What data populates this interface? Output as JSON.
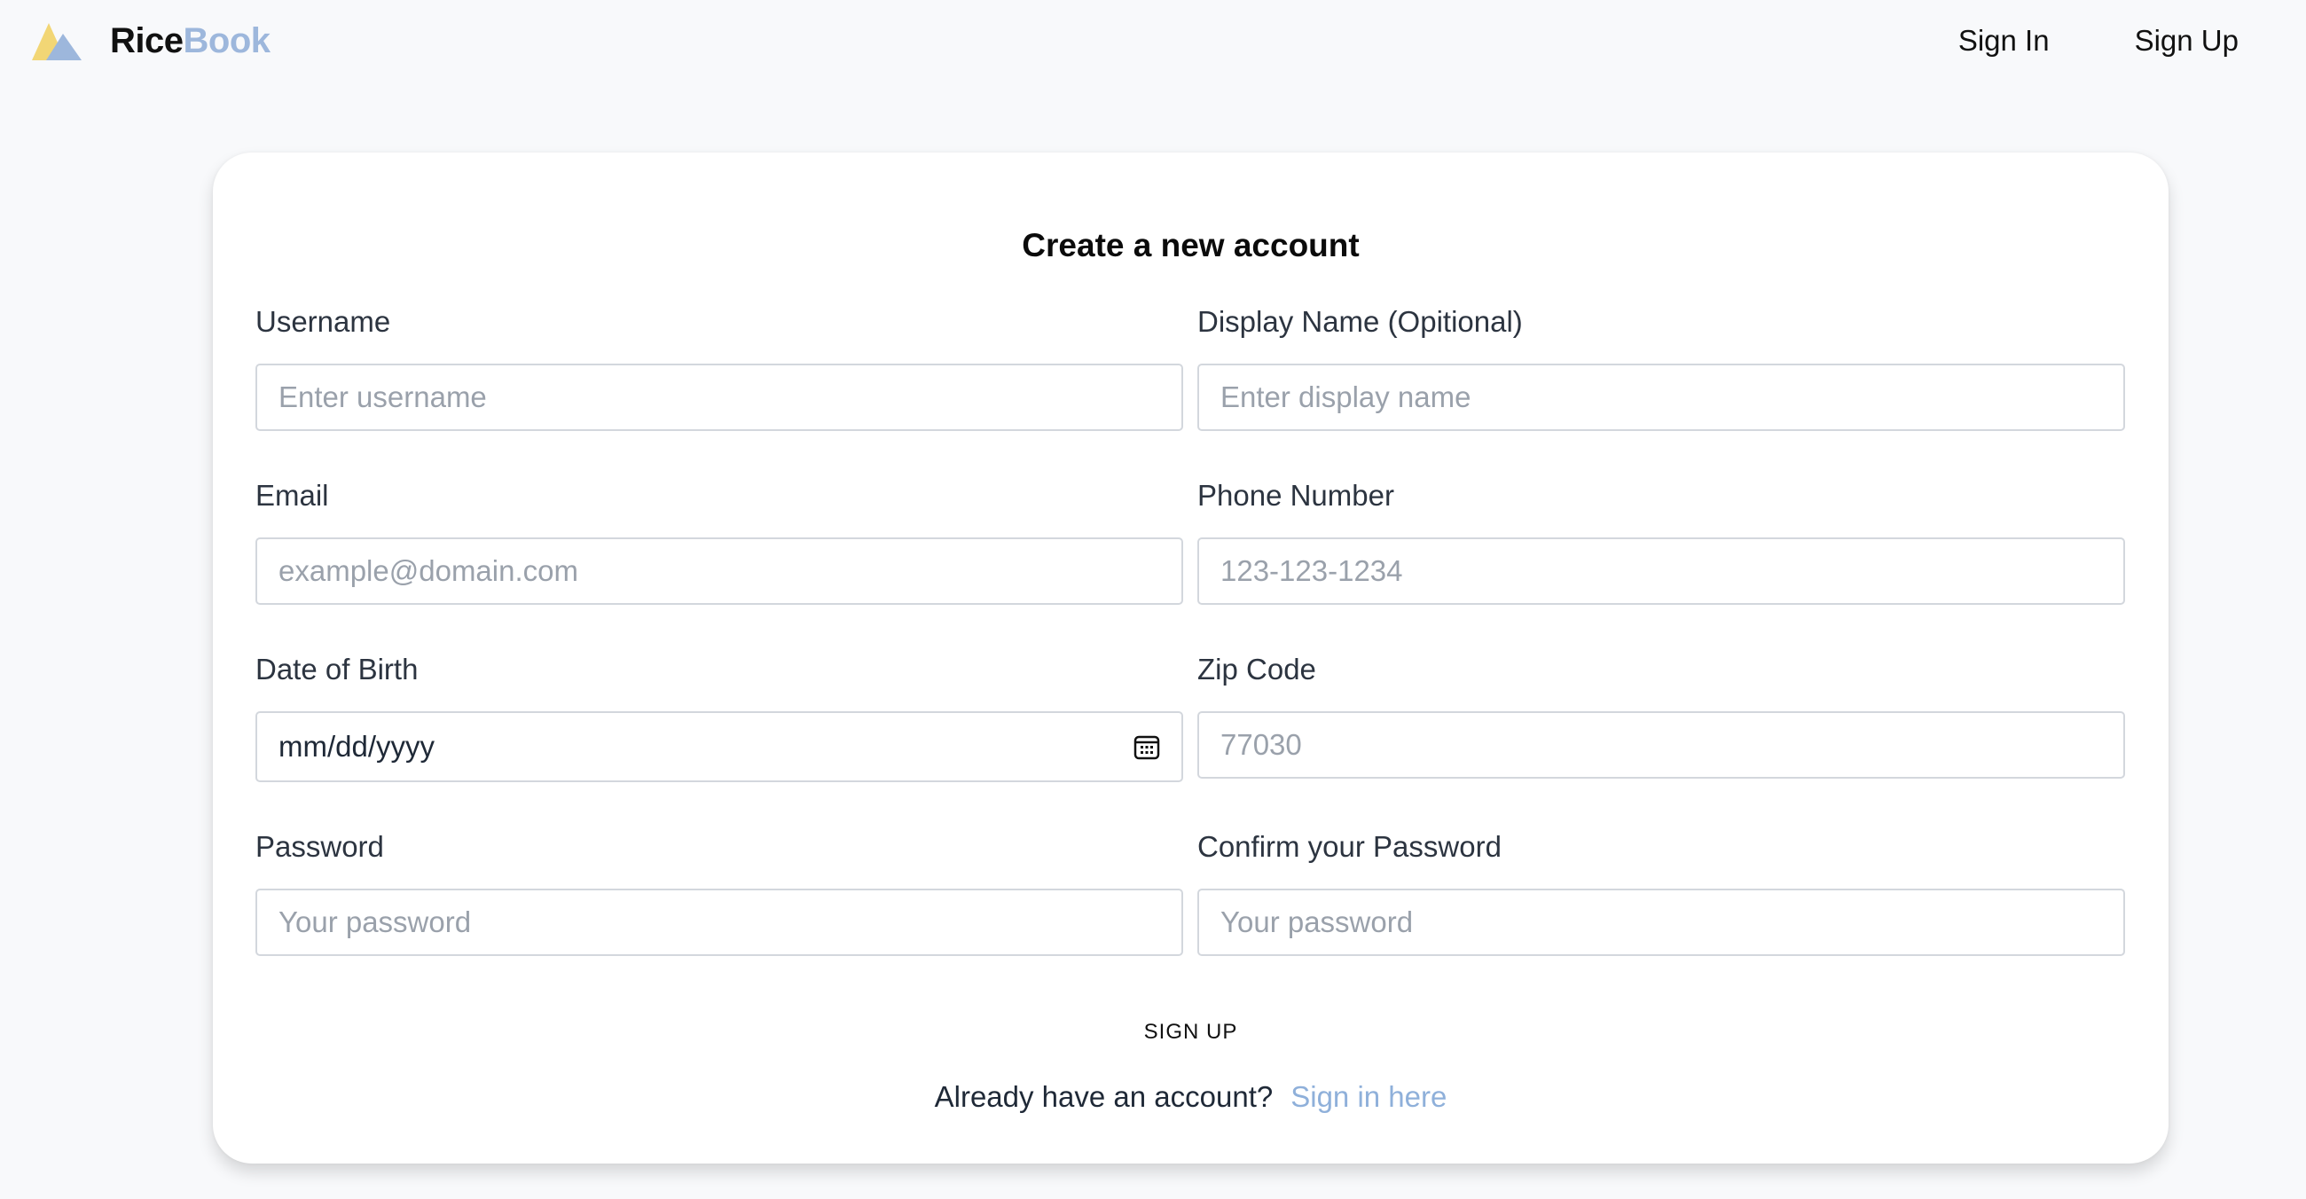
{
  "brand": {
    "name_part1": "Rice",
    "name_part2": "Book",
    "logo_icon": "mountain-logo-icon",
    "colors": {
      "logo_yellow": "#f2d675",
      "logo_blue": "#9db7dc"
    }
  },
  "nav": {
    "sign_in": "Sign In",
    "sign_up": "Sign Up"
  },
  "form": {
    "title": "Create a new account",
    "username": {
      "label": "Username",
      "placeholder": "Enter username"
    },
    "display_name": {
      "label": "Display Name (Opitional)",
      "placeholder": "Enter display name"
    },
    "email": {
      "label": "Email",
      "placeholder": "example@domain.com"
    },
    "phone": {
      "label": "Phone Number",
      "placeholder": "123-123-1234"
    },
    "dob": {
      "label": "Date of Birth",
      "value": "mm/dd/yyyy",
      "icon": "calendar-icon"
    },
    "zip": {
      "label": "Zip Code",
      "placeholder": "77030"
    },
    "password": {
      "label": "Password",
      "placeholder": "Your password"
    },
    "confirm_password": {
      "label": "Confirm your Password",
      "placeholder": "Your password"
    },
    "submit_label": "SIGN UP",
    "have_account_text": "Already have an account?",
    "sign_in_link": "Sign in here"
  },
  "colors": {
    "background": "#f8f9fb",
    "card": "#ffffff",
    "link": "#8fb0da",
    "input_border": "#d3d7dd",
    "placeholder": "#9aa1ab"
  }
}
